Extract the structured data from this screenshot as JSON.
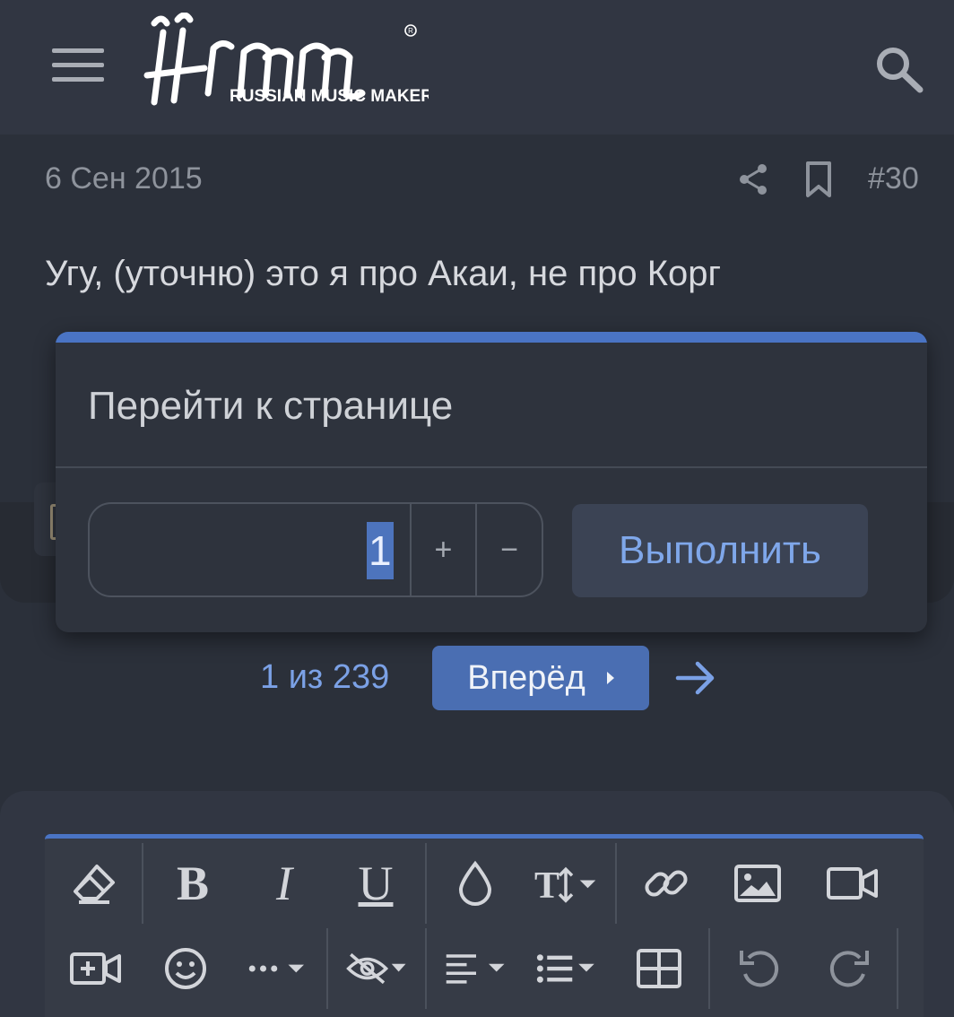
{
  "header": {
    "brand_tagline": "RUSSIAN MUSIC MAKERS",
    "brand_mark": "rmm"
  },
  "post": {
    "date": "6 Сен 2015",
    "number": "#30",
    "text": "Угу, (уточню) это я про Акаи, не про Корг"
  },
  "dialog": {
    "title": "Перейти к странице",
    "page_value": "1",
    "plus": "+",
    "minus": "−",
    "submit": "Выполнить"
  },
  "pagination": {
    "info": "1 из 239",
    "next": "Вперёд"
  },
  "colors": {
    "accent": "#4a74c4",
    "link": "#7ba1e6",
    "background": "#2b303a"
  },
  "toolbar": {
    "row1": [
      "eraser-icon",
      "bold-icon",
      "italic-icon",
      "underline-icon",
      "color-drop-icon",
      "text-size-icon",
      "link-icon",
      "image-icon",
      "video-icon"
    ],
    "row2": [
      "insert-media-icon",
      "smile-icon",
      "more-icon",
      "hide-icon",
      "align-icon",
      "list-icon",
      "table-icon",
      "undo-icon",
      "redo-icon"
    ],
    "bold": "B",
    "italic": "I",
    "underline": "U"
  }
}
